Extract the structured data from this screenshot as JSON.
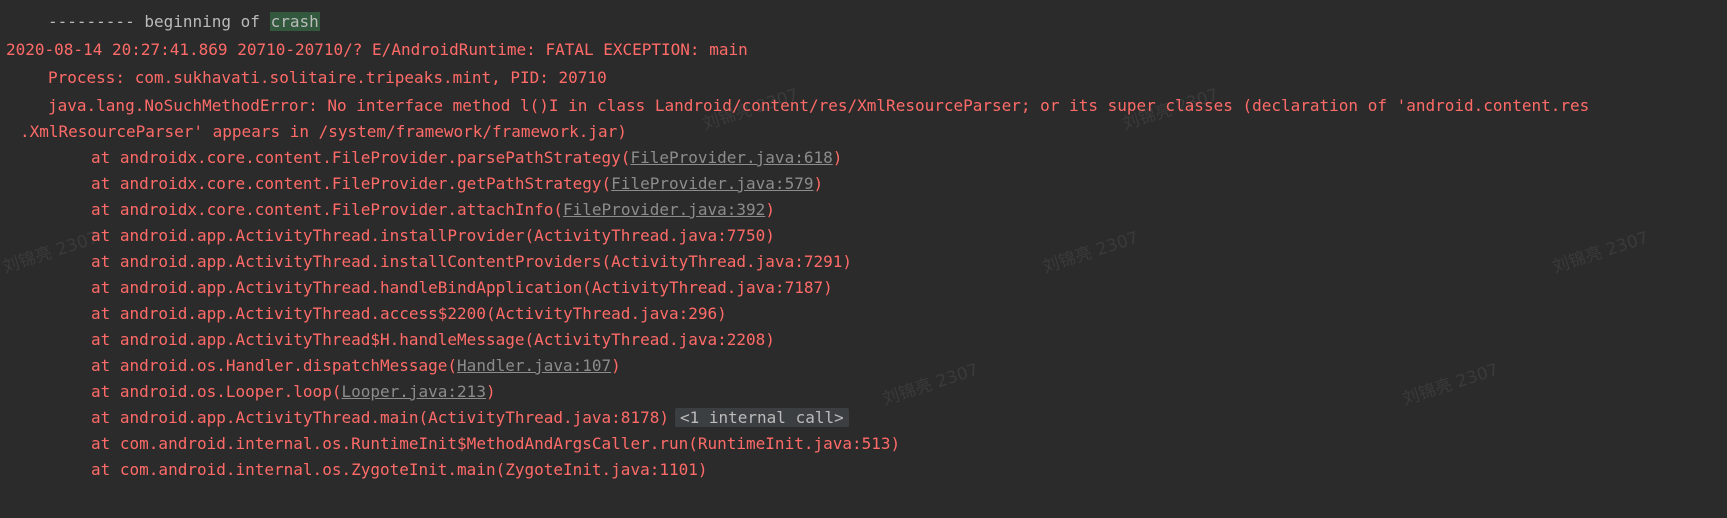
{
  "separator": {
    "dashes": "--------- beginning of ",
    "keyword": "crash"
  },
  "header": {
    "line": "2020-08-14 20:27:41.869 20710-20710/? E/AndroidRuntime: FATAL EXCEPTION: main"
  },
  "process_line": "Process: com.sukhavati.solitaire.tripeaks.mint, PID: 20710",
  "error_line1": "java.lang.NoSuchMethodError: No interface method l()I in class Landroid/content/res/XmlResourceParser; or its super classes (declaration of 'android.content.res",
  "error_line2": ".XmlResourceParser' appears in /system/framework/framework.jar)",
  "frames": [
    {
      "prefix": "at androidx.core.content.FileProvider.parsePathStrategy(",
      "link": "FileProvider.java:618",
      "suffix": ")"
    },
    {
      "prefix": "at androidx.core.content.FileProvider.getPathStrategy(",
      "link": "FileProvider.java:579",
      "suffix": ")"
    },
    {
      "prefix": "at androidx.core.content.FileProvider.attachInfo(",
      "link": "FileProvider.java:392",
      "suffix": ")"
    },
    {
      "prefix": "at android.app.ActivityThread.installProvider(ActivityThread.java:7750)",
      "link": "",
      "suffix": ""
    },
    {
      "prefix": "at android.app.ActivityThread.installContentProviders(ActivityThread.java:7291)",
      "link": "",
      "suffix": ""
    },
    {
      "prefix": "at android.app.ActivityThread.handleBindApplication(ActivityThread.java:7187)",
      "link": "",
      "suffix": ""
    },
    {
      "prefix": "at android.app.ActivityThread.access$2200(ActivityThread.java:296)",
      "link": "",
      "suffix": ""
    },
    {
      "prefix": "at android.app.ActivityThread$H.handleMessage(ActivityThread.java:2208)",
      "link": "",
      "suffix": ""
    },
    {
      "prefix": "at android.os.Handler.dispatchMessage(",
      "link": "Handler.java:107",
      "suffix": ")"
    },
    {
      "prefix": "at android.os.Looper.loop(",
      "link": "Looper.java:213",
      "suffix": ")"
    },
    {
      "prefix": "at android.app.ActivityThread.main(ActivityThread.java:8178)",
      "link": "",
      "suffix": ""
    },
    {
      "prefix": "at com.android.internal.os.RuntimeInit$MethodAndArgsCaller.run(RuntimeInit.java:513)",
      "link": "",
      "suffix": ""
    },
    {
      "prefix": "at com.android.internal.os.ZygoteInit.main(ZygoteInit.java:1101)",
      "link": "",
      "suffix": ""
    }
  ],
  "folded_call": "<1 internal call>",
  "watermark": "刘锦亮 2307",
  "colors": {
    "background": "#2b2b2b",
    "error_text": "#ff6b68",
    "link_text": "#8c8c8c",
    "crash_highlight": "#32593d"
  }
}
